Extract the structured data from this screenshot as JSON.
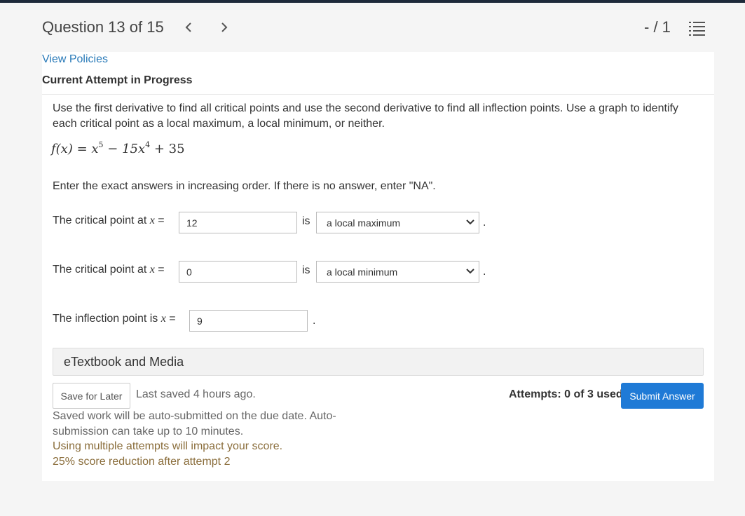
{
  "header": {
    "question_title": "Question 13 of 15",
    "score": "- / 1",
    "prev_icon": "chevron-left-icon",
    "next_icon": "chevron-right-icon",
    "list_icon": "numbered-list-icon"
  },
  "links": {
    "view_policies": "View Policies"
  },
  "section": {
    "title": "Current Attempt in Progress"
  },
  "question": {
    "prompt": "Use the first derivative to find all critical points and use the second derivative to find all inflection points. Use a graph to identify each critical point as a local maximum, a local minimum, or neither.",
    "formula_lhs": "f(x) = x",
    "exp1": "5",
    "middle": " − 15x",
    "exp2": "4",
    "tail": " + 35",
    "instructions": "Enter the exact answers in increasing order. If there is no answer, enter \"NA\"."
  },
  "rows": [
    {
      "label": "The critical point at ",
      "var": "x",
      "eq": " =",
      "value": "12",
      "is": "is",
      "select": "a local maximum",
      "period": "."
    },
    {
      "label": "The critical point at ",
      "var": "x",
      "eq": " =",
      "value": "0",
      "is": "is",
      "select": "a local minimum",
      "period": "."
    },
    {
      "label": "The inflection point is ",
      "var": "x",
      "eq": " =",
      "value": "9",
      "period": "."
    }
  ],
  "etextbook": {
    "label": "eTextbook and Media"
  },
  "footer": {
    "save_label": "Save for Later",
    "last_saved": "Last saved 4 hours ago.",
    "auto_submit": "Saved work will be auto-submitted on the due date. Auto-submission can take up to 10 minutes.",
    "warning1": "Using multiple attempts will impact your score.",
    "warning2": "25% score reduction after attempt 2",
    "attempts": "Attempts: 0 of 3 used",
    "submit_label": "Submit Answer"
  },
  "colors": {
    "link": "#2b7bb9",
    "primary_button": "#1f7ad6",
    "warning_text": "#8a6d3b",
    "top_bar": "#1e2a3a"
  }
}
